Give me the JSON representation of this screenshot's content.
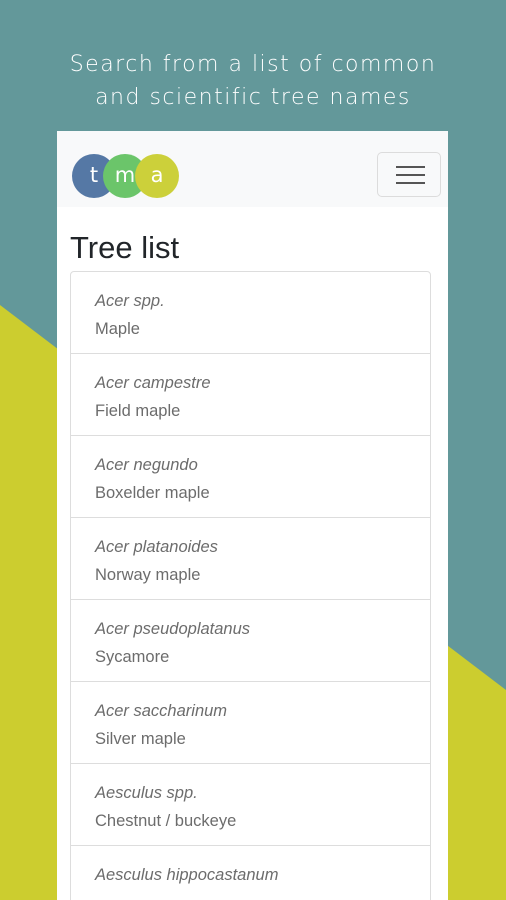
{
  "caption": {
    "line1": "Search from a list of common",
    "line2": "and scientific tree names"
  },
  "logo": {
    "letters": [
      "t",
      "m",
      "a"
    ],
    "colors": [
      "#5578a5",
      "#6bc56a",
      "#ccd03a"
    ]
  },
  "navbar": {
    "menu_icon": "hamburger-icon"
  },
  "page": {
    "title": "Tree list"
  },
  "trees": [
    {
      "scientific": "Acer spp.",
      "common": "Maple"
    },
    {
      "scientific": "Acer campestre",
      "common": "Field maple"
    },
    {
      "scientific": "Acer negundo",
      "common": "Boxelder maple"
    },
    {
      "scientific": "Acer platanoides",
      "common": "Norway maple"
    },
    {
      "scientific": "Acer pseudoplatanus",
      "common": "Sycamore"
    },
    {
      "scientific": "Acer saccharinum",
      "common": "Silver maple"
    },
    {
      "scientific": "Aesculus spp.",
      "common": "Chestnut / buckeye"
    },
    {
      "scientific": "Aesculus hippocastanum",
      "common": ""
    }
  ],
  "colors": {
    "background_teal": "#63989a",
    "background_yellow": "#cccd2f"
  }
}
